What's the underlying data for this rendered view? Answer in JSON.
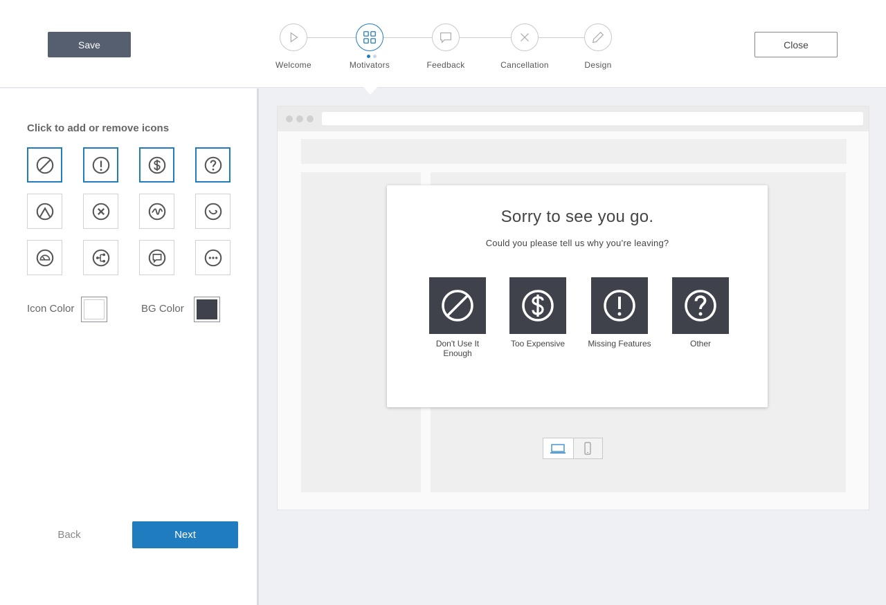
{
  "header": {
    "save_label": "Save",
    "close_label": "Close",
    "steps": [
      {
        "label": "Welcome",
        "icon": "play-icon"
      },
      {
        "label": "Motivators",
        "icon": "grid-icon",
        "active": true
      },
      {
        "label": "Feedback",
        "icon": "chat-bubble-icon"
      },
      {
        "label": "Cancellation",
        "icon": "x-icon"
      },
      {
        "label": "Design",
        "icon": "pencil-icon"
      }
    ]
  },
  "sidebar": {
    "title": "Click to add or remove icons",
    "icons": [
      {
        "name": "ban-icon",
        "selected": true
      },
      {
        "name": "exclamation-icon",
        "selected": true
      },
      {
        "name": "dollar-icon",
        "selected": true
      },
      {
        "name": "question-icon",
        "selected": true
      },
      {
        "name": "mountain-icon",
        "selected": false
      },
      {
        "name": "x-circle-icon",
        "selected": false
      },
      {
        "name": "squiggle-icon",
        "selected": false
      },
      {
        "name": "curve-icon",
        "selected": false
      },
      {
        "name": "gauge-icon",
        "selected": false
      },
      {
        "name": "share-icon",
        "selected": false
      },
      {
        "name": "message-icon",
        "selected": false
      },
      {
        "name": "ellipsis-icon",
        "selected": false
      }
    ],
    "icon_color_label": "Icon Color",
    "icon_color": "#ffffff",
    "bg_color_label": "BG Color",
    "bg_color": "#3f424b",
    "back_label": "Back",
    "next_label": "Next"
  },
  "preview": {
    "title": "Sorry to see you go.",
    "subtitle": "Could you please tell us why you’re leaving?",
    "reasons": [
      {
        "label": "Don't Use It Enough",
        "icon": "ban-icon"
      },
      {
        "label": "Too Expensive",
        "icon": "dollar-icon"
      },
      {
        "label": "Missing Features",
        "icon": "exclamation-icon"
      },
      {
        "label": "Other",
        "icon": "question-icon"
      }
    ],
    "device_selected": "desktop"
  },
  "colors": {
    "accent": "#1f7cbf",
    "save_button": "#555f6f",
    "icon_bg": "#3f424b"
  }
}
